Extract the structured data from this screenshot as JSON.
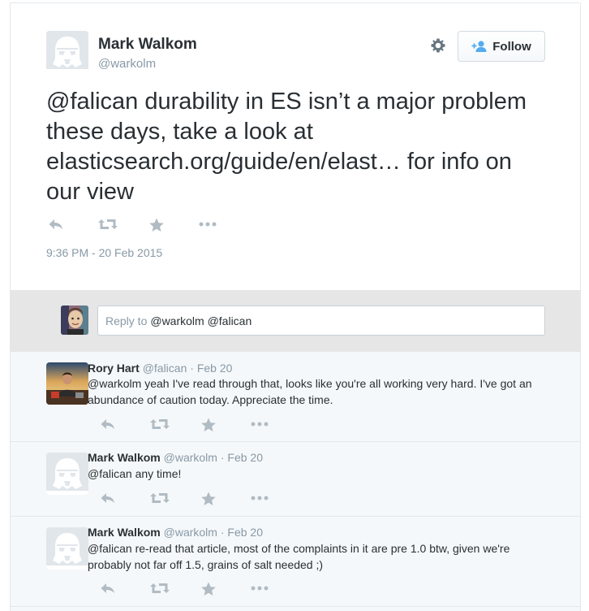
{
  "tweet": {
    "name": "Mark Walkom",
    "handle": "@warkolm",
    "follow_label": "Follow",
    "text_mention": "@falican",
    "text_part1": " durability in ES isn’t a major problem these days, take a look at ",
    "text_link": "elasticsearch.org/guide/en/elast…",
    "text_part2": " for info on our view",
    "timestamp": "9:36 PM - 20 Feb 2015"
  },
  "reply_box": {
    "prefix": "Reply to",
    "value": "@warkolm @falican"
  },
  "replies": [
    {
      "name": "Rory Hart",
      "handle": "@falican",
      "date": "· Feb 20",
      "mention": "@warkolm",
      "text": " yeah I've read through that, looks like you're all working very hard. I've got an abundance of caution today. Appreciate the time."
    },
    {
      "name": "Mark Walkom",
      "handle": "@warkolm",
      "date": "· Feb 20",
      "mention": "@falican",
      "text": " any time!"
    },
    {
      "name": "Mark Walkom",
      "handle": "@warkolm",
      "date": "· Feb 20",
      "mention": "@falican",
      "text": " re-read that article, most of the complaints in it are pre 1.0 btw, given we're probably not far off 1.5, grains of salt needed ;)"
    }
  ],
  "icons": {
    "reply": "reply-icon",
    "retweet": "retweet-icon",
    "favorite": "star-icon",
    "more": "more-icon",
    "settings": "gear-icon",
    "follow": "add-user-icon"
  },
  "colors": {
    "icon_gray": "#b1bbc3",
    "handle_gray": "#8899a6",
    "follow_blue": "#55acee",
    "thread_bg": "#f5f8fa",
    "reply_bar_bg": "#e6e6e6"
  }
}
